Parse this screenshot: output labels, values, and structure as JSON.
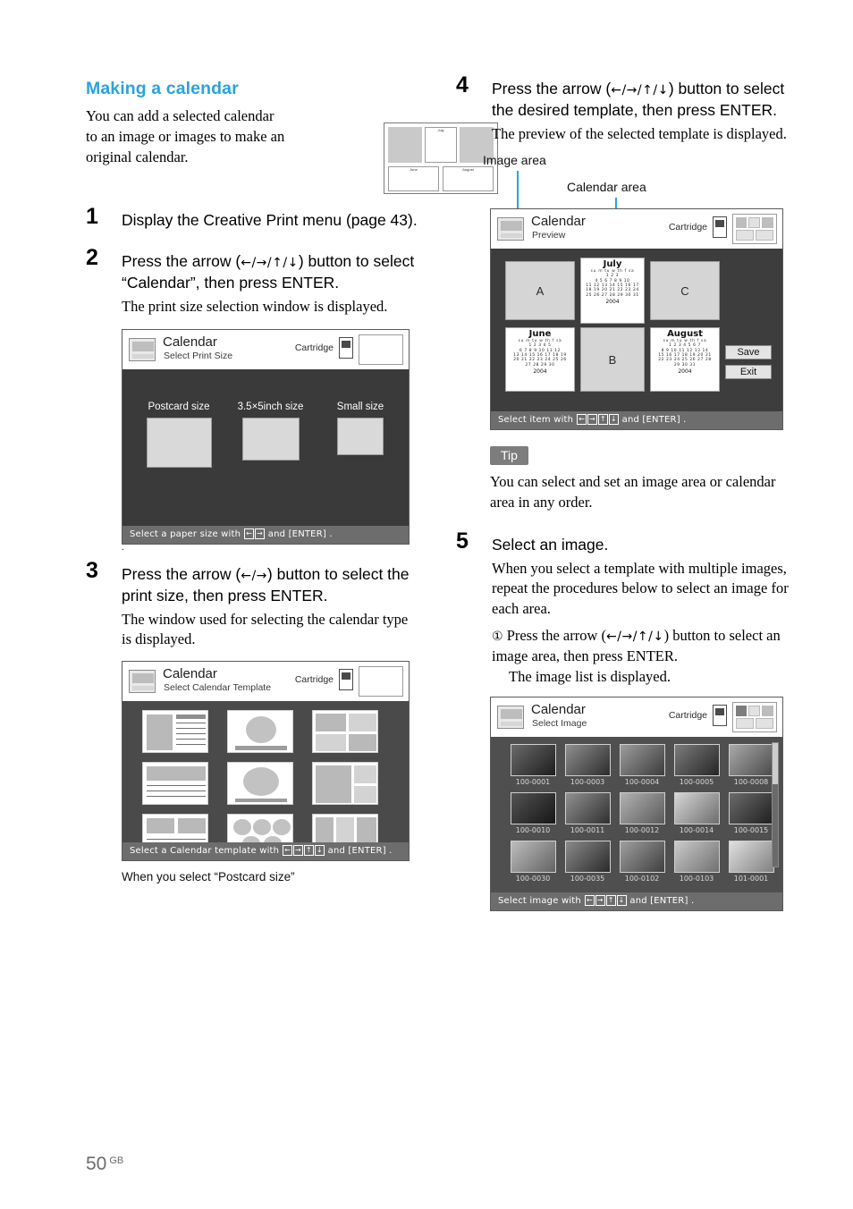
{
  "section": {
    "title": "Making a calendar",
    "intro": "You can add a selected calendar to an image or images to make an original calendar."
  },
  "steps": {
    "s1": {
      "num": "1",
      "head": "Display the Creative Print menu (page 43)."
    },
    "s2": {
      "num": "2",
      "head_a": "Press the arrow (",
      "head_arrows": "←/→/↑/↓",
      "head_b": ") button to select “Calendar”, then press ENTER.",
      "sub": "The print size selection window is displayed."
    },
    "s3": {
      "num": "3",
      "head_a": "Press the arrow (",
      "head_arrows": "←/→",
      "head_b": ") button to select the print size, then press ENTER.",
      "sub": "The window used for selecting the calendar type is displayed.",
      "caption": "When you select “Postcard size”"
    },
    "s4": {
      "num": "4",
      "head_a": "Press the arrow (",
      "head_arrows": "←/→/↑/↓",
      "head_b": ") button to select the desired template, then press ENTER.",
      "sub": "The preview of the selected template is displayed."
    },
    "s5": {
      "num": "5",
      "head": "Select an image.",
      "sub": "When you select a template with multiple images, repeat the procedures below to select an image for each area.",
      "sub1_num": "①",
      "sub1_a": "Press the arrow (",
      "sub1_arrows": "←/→/↑/↓",
      "sub1_b": ") button to select an image area, then press ENTER.",
      "sub1_result": "The image list is displayed."
    }
  },
  "tip": {
    "badge": "Tip",
    "text": "You can select and set an image area or calendar area in any order."
  },
  "callouts": {
    "image_area": "Image area",
    "calendar_area": "Calendar area"
  },
  "screens": {
    "print_size": {
      "title": "Calendar",
      "subtitle": "Select Print Size",
      "cartridge": "Cartridge",
      "items": [
        {
          "label": "Postcard size"
        },
        {
          "label": "3.5×5inch size"
        },
        {
          "label": "Small size"
        }
      ],
      "footer_pre": "Select a paper size with",
      "footer_keys": [
        "←",
        "→"
      ],
      "footer_post": "and [ENTER] ."
    },
    "templates": {
      "title": "Calendar",
      "subtitle": "Select Calendar Template",
      "cartridge": "Cartridge",
      "footer_pre": "Select a Calendar template with",
      "footer_keys": [
        "←",
        "→",
        "↑",
        "↓"
      ],
      "footer_post": "and [ENTER] ."
    },
    "preview": {
      "title": "Calendar",
      "subtitle": "Preview",
      "cartridge": "Cartridge",
      "areas": [
        {
          "label": "A"
        },
        {
          "label": "B"
        },
        {
          "label": "C"
        }
      ],
      "calendars": [
        {
          "month": "July",
          "year": "2004",
          "header": "su  m  tu  w  th  f  sa",
          "rows": [
            "                 1   2   3",
            "4   5   6   7   8   9  10",
            "11 12 13 14 15 16 17",
            "18 19 20 21 22 23 24",
            "25 26 27 28 29 30 31"
          ]
        },
        {
          "month": "June",
          "year": "2004",
          "header": "su  m  tu  w  th  f  sa",
          "rows": [
            "            1   2   3   4   5",
            "6   7   8   9  10 11 12",
            "13 14 15 16 17 18 19",
            "20 21 22 23 24 25 26",
            "27 28 29 30"
          ]
        },
        {
          "month": "August",
          "year": "2004",
          "header": "su  m  tu  w  th  f  sa",
          "rows": [
            "1   2   3   4   5   6   7",
            "8   9  10 11 12 13 14",
            "15 16 17 18 19 20 21",
            "22 23 24 25 26 27 28",
            "29 30 31"
          ]
        }
      ],
      "buttons": [
        {
          "label": "Save"
        },
        {
          "label": "Exit"
        }
      ],
      "footer_pre": "Select item with",
      "footer_keys": [
        "←",
        "→",
        "↑",
        "↓"
      ],
      "footer_post": "and [ENTER] ."
    },
    "select_image": {
      "title": "Calendar",
      "subtitle": "Select Image",
      "cartridge": "Cartridge",
      "thumbnails": [
        {
          "label": "100-0001"
        },
        {
          "label": "100-0003"
        },
        {
          "label": "100-0004"
        },
        {
          "label": "100-0005"
        },
        {
          "label": "100-0008"
        },
        {
          "label": "100-0010"
        },
        {
          "label": "100-0011"
        },
        {
          "label": "100-0012"
        },
        {
          "label": "100-0014"
        },
        {
          "label": "100-0015"
        },
        {
          "label": "100-0030"
        },
        {
          "label": "100-0035"
        },
        {
          "label": "100-0102"
        },
        {
          "label": "100-0103"
        },
        {
          "label": "101-0001"
        }
      ],
      "footer_pre": "Select image with",
      "footer_keys": [
        "←",
        "→",
        "↑",
        "↓"
      ],
      "footer_post": "and [ENTER] ."
    }
  },
  "footer": {
    "page": "50",
    "region": "GB"
  }
}
